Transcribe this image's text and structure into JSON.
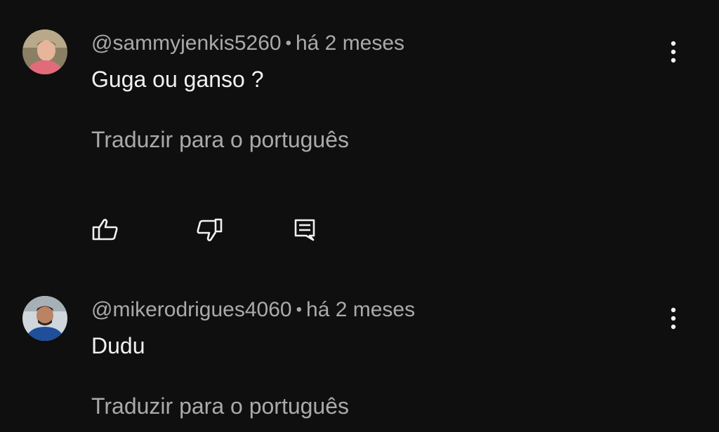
{
  "comments": [
    {
      "author": "@sammyjenkis5260",
      "separator": "•",
      "time": "há 2 meses",
      "text": "Guga ou ganso ?",
      "translate_label": "Traduzir para o português",
      "avatar": {
        "bg": "#c96a6a",
        "skin": "#e7b59a",
        "hair": "#7a5a3a",
        "shirt": "#e26b7a",
        "top": "#8a7f64"
      }
    },
    {
      "author": "@mikerodrigues4060",
      "separator": "•",
      "time": "há 2 meses",
      "text": "Dudu",
      "translate_label": "Traduzir para o português",
      "avatar": {
        "bg": "#cfd6dc",
        "skin": "#b98364",
        "hair": "#2a2420",
        "shirt": "#1f4f9a",
        "top": "#a7b0b6"
      }
    }
  ],
  "icons": {
    "like": "thumbs-up-icon",
    "dislike": "thumbs-down-icon",
    "reply": "reply-icon",
    "more": "more-vert-icon"
  },
  "colors": {
    "background": "#0f0f0f",
    "primary_text": "#f1f1f1",
    "secondary_text": "#aaaaaa"
  }
}
